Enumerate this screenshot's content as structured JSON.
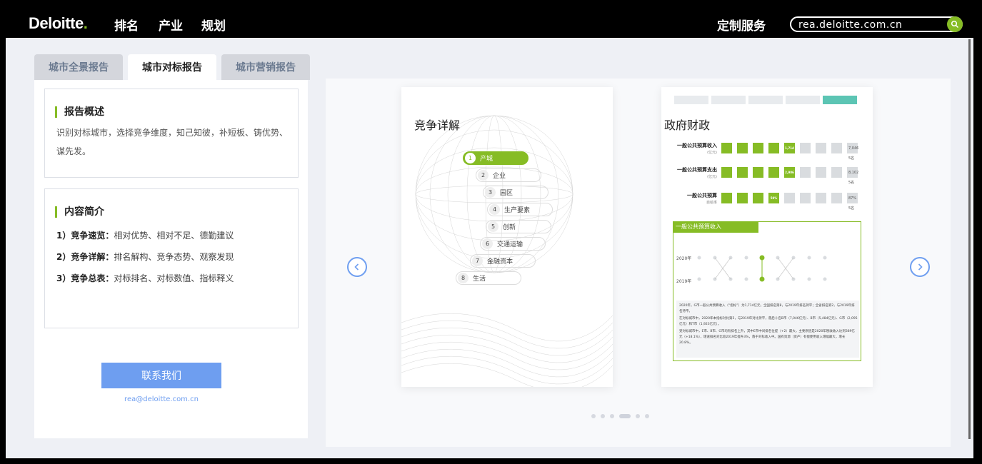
{
  "header": {
    "logo": "Deloitte",
    "logo_dot": ".",
    "nav": [
      "排名",
      "产业",
      "规划"
    ],
    "custom_service": "定制服务",
    "search_value": "rea.deloitte.com.cn"
  },
  "tabs": [
    {
      "label": "城市全景报告",
      "active": false
    },
    {
      "label": "城市对标报告",
      "active": true
    },
    {
      "label": "城市营销报告",
      "active": false
    }
  ],
  "overview": {
    "title": "报告概述",
    "text": "识别对标城市，选择竞争维度，知己知彼，补短板、铸优势、谋先发。"
  },
  "intro": {
    "title": "内容简介",
    "items": [
      {
        "label": "1）竞争速览：",
        "text": "相对优势、相对不足、德勤建议"
      },
      {
        "label": "2）竞争详解：",
        "text": "排名解构、竞争态势、观察发现"
      },
      {
        "label": "3）竞争总表：",
        "text": "对标排名、对标数值、指标释义"
      }
    ]
  },
  "contact": {
    "button": "联系我们",
    "email": "rea@deloitte.com.cn"
  },
  "slide1": {
    "title": "竞争详解",
    "menu": [
      {
        "num": "1",
        "label": "产城",
        "active": true
      },
      {
        "num": "2",
        "label": "企业",
        "active": false
      },
      {
        "num": "3",
        "label": "园区",
        "active": false
      },
      {
        "num": "4",
        "label": "生产要素",
        "active": false
      },
      {
        "num": "5",
        "label": "创新",
        "active": false
      },
      {
        "num": "6",
        "label": "交通运输",
        "active": false
      },
      {
        "num": "7",
        "label": "金融资本",
        "active": false
      },
      {
        "num": "8",
        "label": "生活",
        "active": false
      }
    ]
  },
  "slide2": {
    "title": "政府财政",
    "rows": [
      {
        "label": "一般公共预算收入",
        "sub": "(亿元)",
        "value": "1,714",
        "end": "7,046",
        "rank": "5名"
      },
      {
        "label": "一般公共预算支出",
        "sub": "(亿元)",
        "value": "2,906",
        "end": "8,102",
        "rank": "5名"
      },
      {
        "label": "一般公共预算",
        "sub": "自给率",
        "value": "59%",
        "end": "87%",
        "rank": "5名"
      }
    ],
    "panel_title": "一般公共预算收入",
    "years": [
      "2020年",
      "2019年"
    ],
    "notes": [
      "2020年，G市一般公共预算收入（“指标”）为1,714亿元，全国排名第8，与2019年排名持平；全省排名第2，与2019年排名持平。",
      "在对标城市中，2020年本指标对比第5，与2019年对比持平，落后十名B市（7,046亿元）、B市（5,484亿元）、G市（2,095亿元）和T市（1,923亿元）。",
      "受对标城市中，E市、B市、G市均有排名上升，其中E市中间排名位提（+2）最大，主要原因是2020年税收收入达到389亿元（+18.1%），增速排名对比较2019年提升3%，落于对标收入中。国有资源（资产）有偿使用收入增幅最大，增长20.8%。"
    ]
  },
  "carousel": {
    "dots": 6,
    "active_dot": 3
  }
}
